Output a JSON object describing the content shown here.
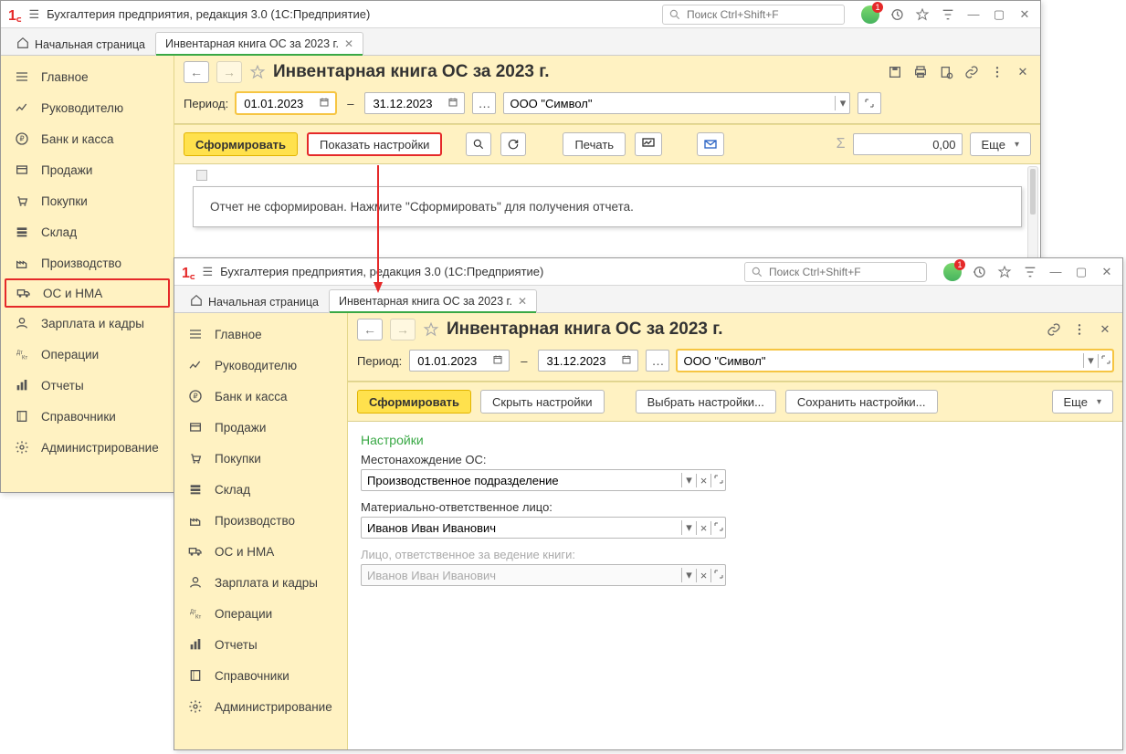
{
  "app": {
    "title": "Бухгалтерия предприятия, редакция 3.0  (1С:Предприятие)",
    "search_placeholder": "Поиск Ctrl+Shift+F"
  },
  "sidebar": {
    "items": [
      {
        "icon": "menu",
        "label": "Главное"
      },
      {
        "icon": "chart",
        "label": "Руководителю"
      },
      {
        "icon": "ruble",
        "label": "Банк и касса"
      },
      {
        "icon": "box",
        "label": "Продажи"
      },
      {
        "icon": "cart",
        "label": "Покупки"
      },
      {
        "icon": "stack",
        "label": "Склад"
      },
      {
        "icon": "factory",
        "label": "Производство"
      },
      {
        "icon": "truck",
        "label": "ОС и НМА"
      },
      {
        "icon": "person",
        "label": "Зарплата и кадры"
      },
      {
        "icon": "ops",
        "label": "Операции"
      },
      {
        "icon": "bar",
        "label": "Отчеты"
      },
      {
        "icon": "book",
        "label": "Справочники"
      },
      {
        "icon": "gear",
        "label": "Администрирование"
      }
    ]
  },
  "tabs": {
    "home": "Начальная страница",
    "doc": "Инвентарная книга ОС за 2023 г."
  },
  "win1": {
    "doc_title": "Инвентарная книга ОС за 2023 г.",
    "period_label": "Период:",
    "date_from": "01.01.2023",
    "dash": "—",
    "date_to": "31.12.2023",
    "org_value": "ООО \"Символ\"",
    "generate_button": "Сформировать",
    "show_settings_button": "Показать настройки",
    "print_button": "Печать",
    "more_button": "Еще",
    "sum_value": "0,00",
    "report_message": "Отчет не сформирован. Нажмите \"Сформировать\" для получения отчета."
  },
  "win2": {
    "doc_title": "Инвентарная книга ОС за 2023 г.",
    "period_label": "Период:",
    "date_from": "01.01.2023",
    "dash": "—",
    "date_to": "31.12.2023",
    "org_value": "ООО \"Символ\"",
    "generate_button": "Сформировать",
    "hide_settings_button": "Скрыть настройки",
    "choose_settings_button": "Выбрать настройки...",
    "save_settings_button": "Сохранить настройки...",
    "more_button": "Еще",
    "settings_title": "Настройки",
    "field_location_label": "Местонахождение ОС:",
    "field_location_value": "Производственное подразделение",
    "field_mol_label": "Материально-ответственное лицо:",
    "field_mol_value": "Иванов Иван Иванович",
    "field_keeper_label": "Лицо, ответственное за ведение книги:",
    "field_keeper_value": "Иванов Иван Иванович"
  }
}
